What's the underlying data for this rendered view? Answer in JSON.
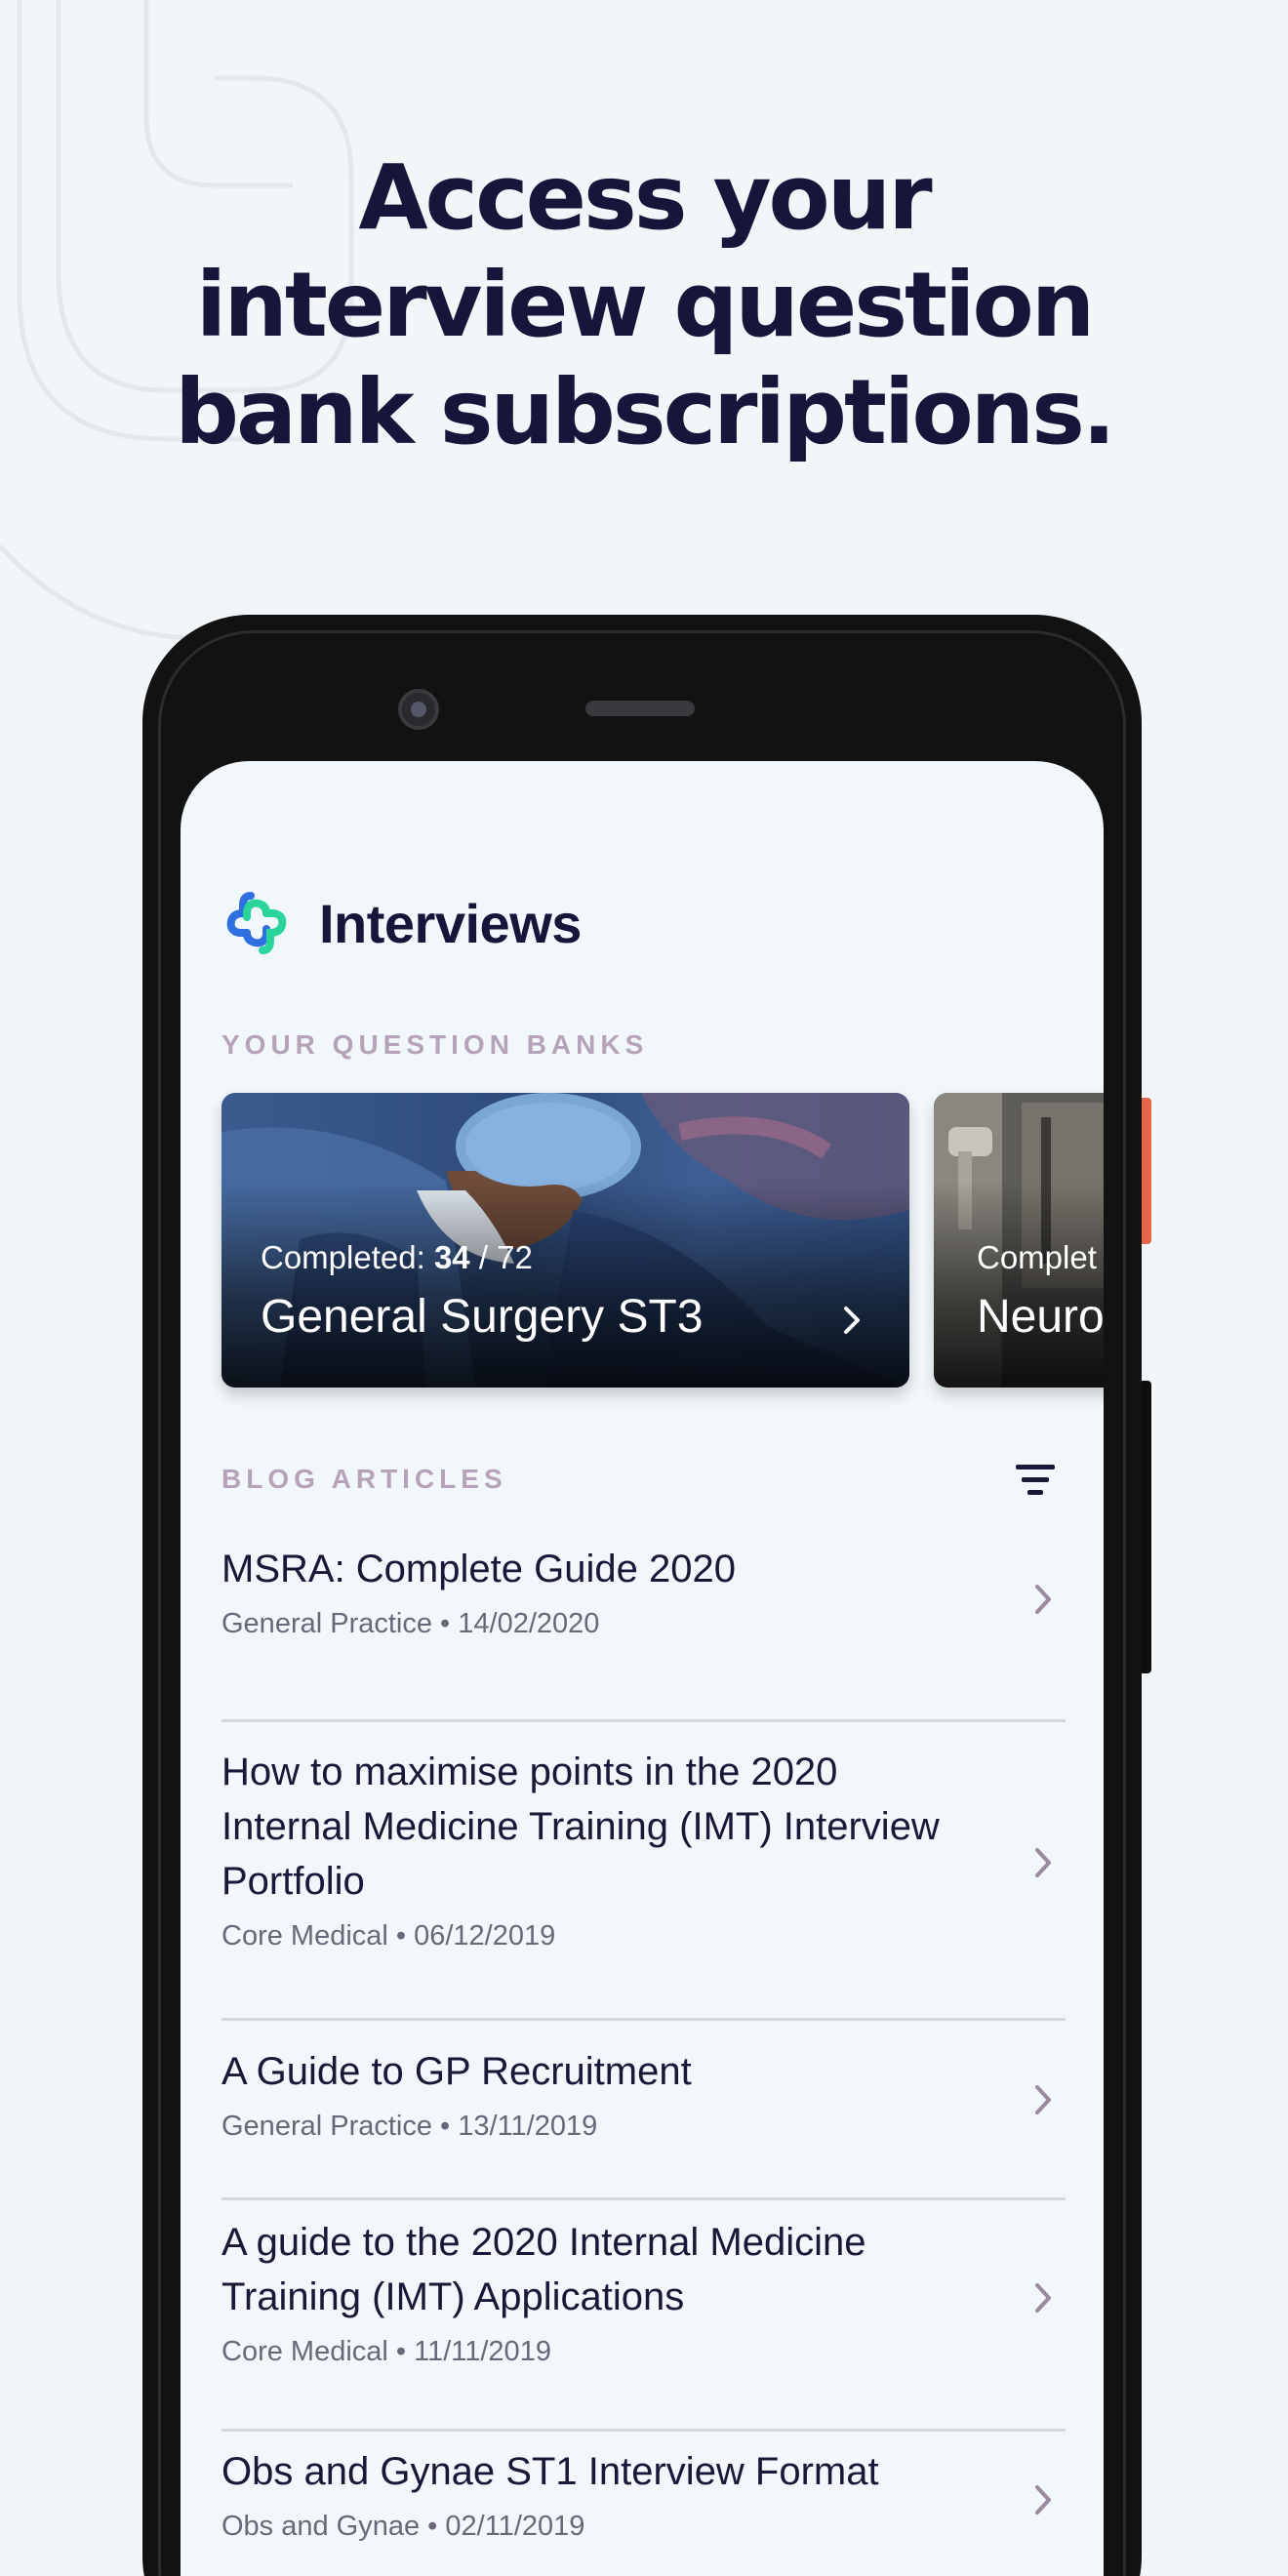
{
  "headline": {
    "line1": "Access your",
    "line2": "interview question",
    "line3": "bank subscriptions."
  },
  "app": {
    "title": "Interviews",
    "logo_icon": "interlocking-rings-logo-icon"
  },
  "question_banks": {
    "label": "YOUR QUESTION BANKS",
    "cards": [
      {
        "progress_label": "Completed: ",
        "completed": "34",
        "total_sep": " / 72",
        "title": "General Surgery ST3"
      },
      {
        "progress_label": "Complet",
        "title": "Neuro"
      }
    ]
  },
  "blog": {
    "label": "BLOG ARTICLES",
    "filter_icon": "filter-icon",
    "articles": [
      {
        "title": "MSRA: Complete Guide 2020",
        "meta": "General Practice • 14/02/2020"
      },
      {
        "title": "How to maximise points in the 2020 Internal Medicine Training (IMT) Interview Portfolio",
        "meta": "Core Medical • 06/12/2019"
      },
      {
        "title": "A Guide to GP Recruitment",
        "meta": "General Practice • 13/11/2019"
      },
      {
        "title": "A guide to the 2020 Internal Medicine Training (IMT) Applications",
        "meta": "Core Medical • 11/11/2019"
      },
      {
        "title": "Obs and Gynae ST1 Interview Format",
        "meta": "Obs and Gynae • 02/11/2019"
      }
    ]
  },
  "colors": {
    "background": "#f2f6f9",
    "headline": "#17163a",
    "section_label": "#b7a3b9",
    "logo_blue": "#2f6fe0",
    "logo_green": "#2bd49b",
    "side_button_accent": "#e4674c"
  }
}
